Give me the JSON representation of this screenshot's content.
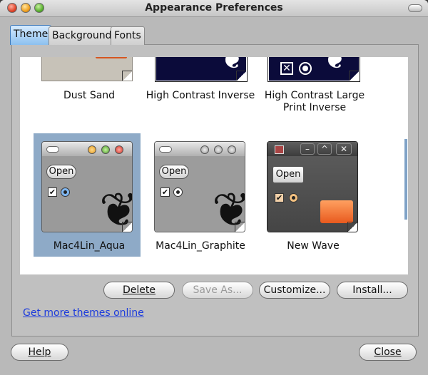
{
  "window": {
    "title": "Appearance Preferences"
  },
  "tabs": [
    {
      "label": "Theme"
    },
    {
      "label": "Background"
    },
    {
      "label": "Fonts"
    }
  ],
  "themes": [
    {
      "name": "Dust Sand",
      "selected": false
    },
    {
      "name": "High Contrast Inverse",
      "selected": false
    },
    {
      "name": "High Contrast Large Print Inverse",
      "selected": false
    },
    {
      "name": "Mac4Lin_Aqua",
      "selected": true
    },
    {
      "name": "Mac4Lin_Graphite",
      "selected": false
    },
    {
      "name": "New Wave",
      "selected": false
    }
  ],
  "preview": {
    "open_label": "Open"
  },
  "buttons": {
    "delete": "Delete",
    "save_as": "Save As...",
    "customize": "Customize...",
    "install": "Install...",
    "help": "Help",
    "close": "Close"
  },
  "link": {
    "get_more": "Get more themes online"
  }
}
